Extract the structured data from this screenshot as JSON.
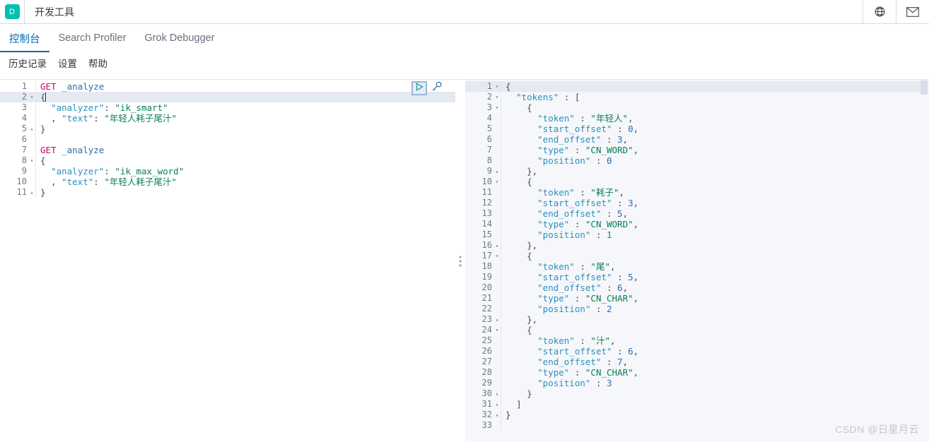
{
  "header": {
    "logo_letter": "D",
    "title": "开发工具",
    "icons": [
      {
        "name": "globe-icon",
        "glyph": "globe"
      },
      {
        "name": "mail-icon",
        "glyph": "envelope"
      }
    ]
  },
  "primary_tabs": [
    {
      "label": "控制台",
      "active": true
    },
    {
      "label": "Search Profiler",
      "active": false
    },
    {
      "label": "Grok Debugger",
      "active": false
    }
  ],
  "secondary_menu": [
    {
      "label": "历史记录"
    },
    {
      "label": "设置"
    },
    {
      "label": "帮助"
    }
  ],
  "editor_actions": {
    "play_label": "▷",
    "play_name": "send-request-play-button",
    "wrench_name": "wrench-icon"
  },
  "editor": {
    "name": "request-editor",
    "lines": [
      {
        "n": "1",
        "fold": "",
        "hl": false,
        "tokens": [
          {
            "c": "t-method",
            "t": "GET"
          },
          {
            "c": "t-punc",
            "t": " "
          },
          {
            "c": "t-url",
            "t": "_analyze"
          }
        ]
      },
      {
        "n": "2",
        "fold": "▾",
        "hl": true,
        "tokens": [
          {
            "c": "t-brace",
            "t": "{"
          }
        ]
      },
      {
        "n": "3",
        "fold": "",
        "hl": false,
        "tokens": [
          {
            "c": "t-punc",
            "t": "  "
          },
          {
            "c": "t-key",
            "t": "\"analyzer\""
          },
          {
            "c": "t-punc",
            "t": ": "
          },
          {
            "c": "t-str",
            "t": "\"ik_smart\""
          }
        ]
      },
      {
        "n": "4",
        "fold": "",
        "hl": false,
        "tokens": [
          {
            "c": "t-punc",
            "t": "  , "
          },
          {
            "c": "t-key",
            "t": "\"text\""
          },
          {
            "c": "t-punc",
            "t": ": "
          },
          {
            "c": "t-str",
            "t": "\"年轻人耗子尾汁\""
          }
        ]
      },
      {
        "n": "5",
        "fold": "▴",
        "hl": false,
        "tokens": [
          {
            "c": "t-brace",
            "t": "}"
          }
        ]
      },
      {
        "n": "6",
        "fold": "",
        "hl": false,
        "tokens": [
          {
            "c": "t-punc",
            "t": ""
          }
        ]
      },
      {
        "n": "7",
        "fold": "",
        "hl": false,
        "tokens": [
          {
            "c": "t-method",
            "t": "GET"
          },
          {
            "c": "t-punc",
            "t": " "
          },
          {
            "c": "t-url",
            "t": "_analyze"
          }
        ]
      },
      {
        "n": "8",
        "fold": "▾",
        "hl": false,
        "tokens": [
          {
            "c": "t-brace",
            "t": "{"
          }
        ]
      },
      {
        "n": "9",
        "fold": "",
        "hl": false,
        "tokens": [
          {
            "c": "t-punc",
            "t": "  "
          },
          {
            "c": "t-key",
            "t": "\"analyzer\""
          },
          {
            "c": "t-punc",
            "t": ": "
          },
          {
            "c": "t-str",
            "t": "\"ik_max_word\""
          }
        ]
      },
      {
        "n": "10",
        "fold": "",
        "hl": false,
        "tokens": [
          {
            "c": "t-punc",
            "t": "  , "
          },
          {
            "c": "t-key",
            "t": "\"text\""
          },
          {
            "c": "t-punc",
            "t": ": "
          },
          {
            "c": "t-str",
            "t": "\"年轻人耗子尾汁\""
          }
        ]
      },
      {
        "n": "11",
        "fold": "▴",
        "hl": false,
        "tokens": [
          {
            "c": "t-brace",
            "t": "}"
          }
        ]
      }
    ]
  },
  "response": {
    "name": "response-viewer",
    "lines": [
      {
        "n": "1",
        "fold": "▾",
        "hl": true,
        "tokens": [
          {
            "c": "t-brace",
            "t": "{"
          }
        ]
      },
      {
        "n": "2",
        "fold": "▾",
        "hl": false,
        "tokens": [
          {
            "c": "t-punc",
            "t": "  "
          },
          {
            "c": "t-key",
            "t": "\"tokens\""
          },
          {
            "c": "t-punc",
            "t": " : "
          },
          {
            "c": "t-brace",
            "t": "["
          }
        ]
      },
      {
        "n": "3",
        "fold": "▾",
        "hl": false,
        "tokens": [
          {
            "c": "t-punc",
            "t": "    "
          },
          {
            "c": "t-brace",
            "t": "{"
          }
        ]
      },
      {
        "n": "4",
        "fold": "",
        "hl": false,
        "tokens": [
          {
            "c": "t-punc",
            "t": "      "
          },
          {
            "c": "t-key",
            "t": "\"token\""
          },
          {
            "c": "t-punc",
            "t": " : "
          },
          {
            "c": "t-str",
            "t": "\"年轻人\""
          },
          {
            "c": "t-punc",
            "t": ","
          }
        ]
      },
      {
        "n": "5",
        "fold": "",
        "hl": false,
        "tokens": [
          {
            "c": "t-punc",
            "t": "      "
          },
          {
            "c": "t-key",
            "t": "\"start_offset\""
          },
          {
            "c": "t-punc",
            "t": " : "
          },
          {
            "c": "t-num",
            "t": "0"
          },
          {
            "c": "t-punc",
            "t": ","
          }
        ]
      },
      {
        "n": "6",
        "fold": "",
        "hl": false,
        "tokens": [
          {
            "c": "t-punc",
            "t": "      "
          },
          {
            "c": "t-key",
            "t": "\"end_offset\""
          },
          {
            "c": "t-punc",
            "t": " : "
          },
          {
            "c": "t-num",
            "t": "3"
          },
          {
            "c": "t-punc",
            "t": ","
          }
        ]
      },
      {
        "n": "7",
        "fold": "",
        "hl": false,
        "tokens": [
          {
            "c": "t-punc",
            "t": "      "
          },
          {
            "c": "t-key",
            "t": "\"type\""
          },
          {
            "c": "t-punc",
            "t": " : "
          },
          {
            "c": "t-str",
            "t": "\"CN_WORD\""
          },
          {
            "c": "t-punc",
            "t": ","
          }
        ]
      },
      {
        "n": "8",
        "fold": "",
        "hl": false,
        "tokens": [
          {
            "c": "t-punc",
            "t": "      "
          },
          {
            "c": "t-key",
            "t": "\"position\""
          },
          {
            "c": "t-punc",
            "t": " : "
          },
          {
            "c": "t-num",
            "t": "0"
          }
        ]
      },
      {
        "n": "9",
        "fold": "▴",
        "hl": false,
        "tokens": [
          {
            "c": "t-punc",
            "t": "    "
          },
          {
            "c": "t-brace",
            "t": "},"
          }
        ]
      },
      {
        "n": "10",
        "fold": "▾",
        "hl": false,
        "tokens": [
          {
            "c": "t-punc",
            "t": "    "
          },
          {
            "c": "t-brace",
            "t": "{"
          }
        ]
      },
      {
        "n": "11",
        "fold": "",
        "hl": false,
        "tokens": [
          {
            "c": "t-punc",
            "t": "      "
          },
          {
            "c": "t-key",
            "t": "\"token\""
          },
          {
            "c": "t-punc",
            "t": " : "
          },
          {
            "c": "t-str",
            "t": "\"耗子\""
          },
          {
            "c": "t-punc",
            "t": ","
          }
        ]
      },
      {
        "n": "12",
        "fold": "",
        "hl": false,
        "tokens": [
          {
            "c": "t-punc",
            "t": "      "
          },
          {
            "c": "t-key",
            "t": "\"start_offset\""
          },
          {
            "c": "t-punc",
            "t": " : "
          },
          {
            "c": "t-num",
            "t": "3"
          },
          {
            "c": "t-punc",
            "t": ","
          }
        ]
      },
      {
        "n": "13",
        "fold": "",
        "hl": false,
        "tokens": [
          {
            "c": "t-punc",
            "t": "      "
          },
          {
            "c": "t-key",
            "t": "\"end_offset\""
          },
          {
            "c": "t-punc",
            "t": " : "
          },
          {
            "c": "t-num",
            "t": "5"
          },
          {
            "c": "t-punc",
            "t": ","
          }
        ]
      },
      {
        "n": "14",
        "fold": "",
        "hl": false,
        "tokens": [
          {
            "c": "t-punc",
            "t": "      "
          },
          {
            "c": "t-key",
            "t": "\"type\""
          },
          {
            "c": "t-punc",
            "t": " : "
          },
          {
            "c": "t-str",
            "t": "\"CN_WORD\""
          },
          {
            "c": "t-punc",
            "t": ","
          }
        ]
      },
      {
        "n": "15",
        "fold": "",
        "hl": false,
        "tokens": [
          {
            "c": "t-punc",
            "t": "      "
          },
          {
            "c": "t-key",
            "t": "\"position\""
          },
          {
            "c": "t-punc",
            "t": " : "
          },
          {
            "c": "t-num",
            "t": "1"
          }
        ]
      },
      {
        "n": "16",
        "fold": "▴",
        "hl": false,
        "tokens": [
          {
            "c": "t-punc",
            "t": "    "
          },
          {
            "c": "t-brace",
            "t": "},"
          }
        ]
      },
      {
        "n": "17",
        "fold": "▾",
        "hl": false,
        "tokens": [
          {
            "c": "t-punc",
            "t": "    "
          },
          {
            "c": "t-brace",
            "t": "{"
          }
        ]
      },
      {
        "n": "18",
        "fold": "",
        "hl": false,
        "tokens": [
          {
            "c": "t-punc",
            "t": "      "
          },
          {
            "c": "t-key",
            "t": "\"token\""
          },
          {
            "c": "t-punc",
            "t": " : "
          },
          {
            "c": "t-str",
            "t": "\"尾\""
          },
          {
            "c": "t-punc",
            "t": ","
          }
        ]
      },
      {
        "n": "19",
        "fold": "",
        "hl": false,
        "tokens": [
          {
            "c": "t-punc",
            "t": "      "
          },
          {
            "c": "t-key",
            "t": "\"start_offset\""
          },
          {
            "c": "t-punc",
            "t": " : "
          },
          {
            "c": "t-num",
            "t": "5"
          },
          {
            "c": "t-punc",
            "t": ","
          }
        ]
      },
      {
        "n": "20",
        "fold": "",
        "hl": false,
        "tokens": [
          {
            "c": "t-punc",
            "t": "      "
          },
          {
            "c": "t-key",
            "t": "\"end_offset\""
          },
          {
            "c": "t-punc",
            "t": " : "
          },
          {
            "c": "t-num",
            "t": "6"
          },
          {
            "c": "t-punc",
            "t": ","
          }
        ]
      },
      {
        "n": "21",
        "fold": "",
        "hl": false,
        "tokens": [
          {
            "c": "t-punc",
            "t": "      "
          },
          {
            "c": "t-key",
            "t": "\"type\""
          },
          {
            "c": "t-punc",
            "t": " : "
          },
          {
            "c": "t-str",
            "t": "\"CN_CHAR\""
          },
          {
            "c": "t-punc",
            "t": ","
          }
        ]
      },
      {
        "n": "22",
        "fold": "",
        "hl": false,
        "tokens": [
          {
            "c": "t-punc",
            "t": "      "
          },
          {
            "c": "t-key",
            "t": "\"position\""
          },
          {
            "c": "t-punc",
            "t": " : "
          },
          {
            "c": "t-num",
            "t": "2"
          }
        ]
      },
      {
        "n": "23",
        "fold": "▴",
        "hl": false,
        "tokens": [
          {
            "c": "t-punc",
            "t": "    "
          },
          {
            "c": "t-brace",
            "t": "},"
          }
        ]
      },
      {
        "n": "24",
        "fold": "▾",
        "hl": false,
        "tokens": [
          {
            "c": "t-punc",
            "t": "    "
          },
          {
            "c": "t-brace",
            "t": "{"
          }
        ]
      },
      {
        "n": "25",
        "fold": "",
        "hl": false,
        "tokens": [
          {
            "c": "t-punc",
            "t": "      "
          },
          {
            "c": "t-key",
            "t": "\"token\""
          },
          {
            "c": "t-punc",
            "t": " : "
          },
          {
            "c": "t-str",
            "t": "\"汁\""
          },
          {
            "c": "t-punc",
            "t": ","
          }
        ]
      },
      {
        "n": "26",
        "fold": "",
        "hl": false,
        "tokens": [
          {
            "c": "t-punc",
            "t": "      "
          },
          {
            "c": "t-key",
            "t": "\"start_offset\""
          },
          {
            "c": "t-punc",
            "t": " : "
          },
          {
            "c": "t-num",
            "t": "6"
          },
          {
            "c": "t-punc",
            "t": ","
          }
        ]
      },
      {
        "n": "27",
        "fold": "",
        "hl": false,
        "tokens": [
          {
            "c": "t-punc",
            "t": "      "
          },
          {
            "c": "t-key",
            "t": "\"end_offset\""
          },
          {
            "c": "t-punc",
            "t": " : "
          },
          {
            "c": "t-num",
            "t": "7"
          },
          {
            "c": "t-punc",
            "t": ","
          }
        ]
      },
      {
        "n": "28",
        "fold": "",
        "hl": false,
        "tokens": [
          {
            "c": "t-punc",
            "t": "      "
          },
          {
            "c": "t-key",
            "t": "\"type\""
          },
          {
            "c": "t-punc",
            "t": " : "
          },
          {
            "c": "t-str",
            "t": "\"CN_CHAR\""
          },
          {
            "c": "t-punc",
            "t": ","
          }
        ]
      },
      {
        "n": "29",
        "fold": "",
        "hl": false,
        "tokens": [
          {
            "c": "t-punc",
            "t": "      "
          },
          {
            "c": "t-key",
            "t": "\"position\""
          },
          {
            "c": "t-punc",
            "t": " : "
          },
          {
            "c": "t-num",
            "t": "3"
          }
        ]
      },
      {
        "n": "30",
        "fold": "▴",
        "hl": false,
        "tokens": [
          {
            "c": "t-punc",
            "t": "    "
          },
          {
            "c": "t-brace",
            "t": "}"
          }
        ]
      },
      {
        "n": "31",
        "fold": "▴",
        "hl": false,
        "tokens": [
          {
            "c": "t-punc",
            "t": "  "
          },
          {
            "c": "t-brace",
            "t": "]"
          }
        ]
      },
      {
        "n": "32",
        "fold": "▴",
        "hl": false,
        "tokens": [
          {
            "c": "t-brace",
            "t": "}"
          }
        ]
      },
      {
        "n": "33",
        "fold": "",
        "hl": false,
        "tokens": [
          {
            "c": "t-punc",
            "t": ""
          }
        ]
      }
    ]
  },
  "watermark": "CSDN @日星月云",
  "colors": {
    "brand_teal": "#00bfb3",
    "accent_blue": "#006bb4",
    "string_green": "#0a7d57",
    "method_pink": "#c80a68",
    "key_blue": "#2d8fbd",
    "highlight_row": "#e4e9f2",
    "response_bg": "#f5f7fa"
  }
}
